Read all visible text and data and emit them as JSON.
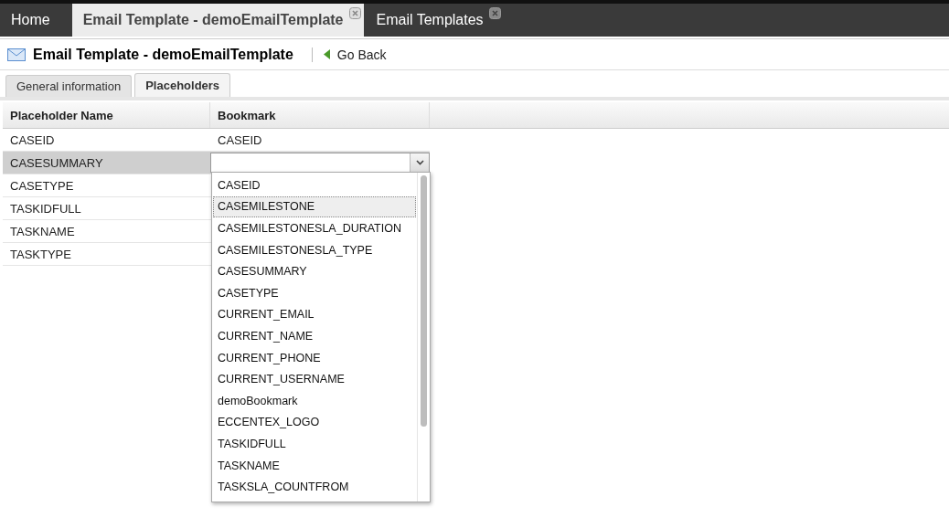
{
  "app_tabs": [
    {
      "label": "Home",
      "selected": false,
      "closable": false
    },
    {
      "label": "Email Template - demoEmailTemplate",
      "selected": true,
      "closable": true
    },
    {
      "label": "Email Templates",
      "selected": false,
      "closable": true
    }
  ],
  "header": {
    "title": "Email Template - demoEmailTemplate",
    "back_label": "Go Back"
  },
  "tabs": [
    {
      "label": "General information",
      "selected": false
    },
    {
      "label": "Placeholders",
      "selected": true
    }
  ],
  "table": {
    "columns": [
      "Placeholder Name",
      "Bookmark"
    ],
    "rows": [
      {
        "name": "CASEID",
        "kind": "text",
        "bookmark": "CASEID",
        "selected": false
      },
      {
        "name": "CASESUMMARY",
        "kind": "editor",
        "bookmark": "",
        "selected": true
      },
      {
        "name": "CASETYPE",
        "kind": "text",
        "selected": false
      },
      {
        "name": "TASKIDFULL",
        "kind": "text",
        "selected": false
      },
      {
        "name": "TASKNAME",
        "kind": "text",
        "selected": false
      },
      {
        "name": "TASKTYPE",
        "kind": "text",
        "selected": false
      }
    ]
  },
  "dropdown": {
    "items": [
      {
        "label": "CASEID",
        "selected": false
      },
      {
        "label": "CASEMILESTONE",
        "selected": true
      },
      {
        "label": "CASEMILESTONESLA_DURATION",
        "selected": false
      },
      {
        "label": "CASEMILESTONESLA_TYPE",
        "selected": false
      },
      {
        "label": "CASESUMMARY",
        "selected": false
      },
      {
        "label": "CASETYPE",
        "selected": false
      },
      {
        "label": "CURRENT_EMAIL",
        "selected": false
      },
      {
        "label": "CURRENT_NAME",
        "selected": false
      },
      {
        "label": "CURRENT_PHONE",
        "selected": false
      },
      {
        "label": "CURRENT_USERNAME",
        "selected": false
      },
      {
        "label": "demoBookmark",
        "selected": false
      },
      {
        "label": "ECCENTEX_LOGO",
        "selected": false
      },
      {
        "label": "TASKIDFULL",
        "selected": false
      },
      {
        "label": "TASKNAME",
        "selected": false
      },
      {
        "label": "TASKSLA_COUNTFROM",
        "selected": false
      }
    ]
  }
}
